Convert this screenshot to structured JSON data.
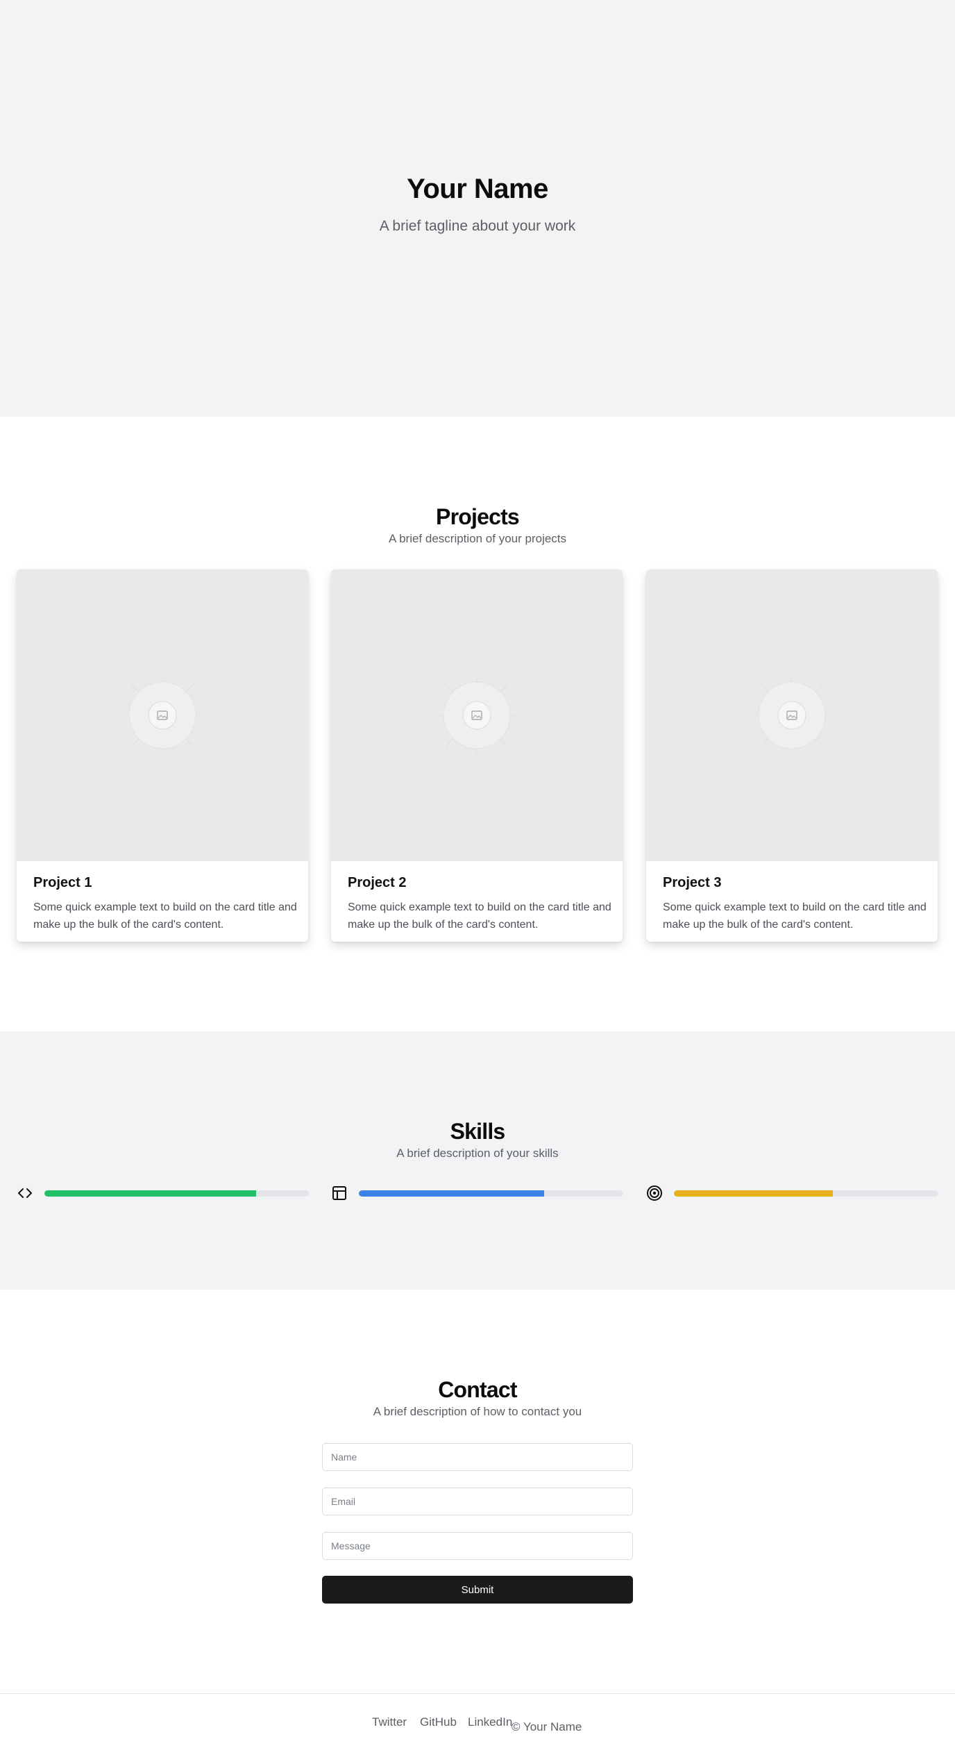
{
  "hero": {
    "name": "Your Name",
    "tagline": "A brief tagline about your work"
  },
  "projects": {
    "title": "Projects",
    "subtitle": "A brief description of your projects",
    "cards": [
      {
        "title": "Project 1",
        "text": "Some quick example text to build on the card title and make up the bulk of the card's content.",
        "image_icon": "image-placeholder-icon"
      },
      {
        "title": "Project 2",
        "text": "Some quick example text to build on the card title and make up the bulk of the card's content.",
        "image_icon": "image-placeholder-icon"
      },
      {
        "title": "Project 3",
        "text": "Some quick example text to build on the card title and make up the bulk of the card's content.",
        "image_icon": "image-placeholder-icon"
      }
    ]
  },
  "skills": {
    "title": "Skills",
    "subtitle": "A brief description of your skills",
    "items": [
      {
        "icon": "code-icon",
        "level": 0.8,
        "color": "#22c066"
      },
      {
        "icon": "layout-icon",
        "level": 0.7,
        "color": "#3b82e6"
      },
      {
        "icon": "target-icon",
        "level": 0.6,
        "color": "#e6b018"
      }
    ]
  },
  "contact": {
    "title": "Contact",
    "subtitle": "A brief description of how to contact you",
    "name_placeholder": "Name",
    "email_placeholder": "Email",
    "message_placeholder": "Message",
    "submit_label": "Submit"
  },
  "footer": {
    "links": [
      "Twitter",
      "GitHub",
      "LinkedIn"
    ],
    "copyright": "© Your Name"
  }
}
